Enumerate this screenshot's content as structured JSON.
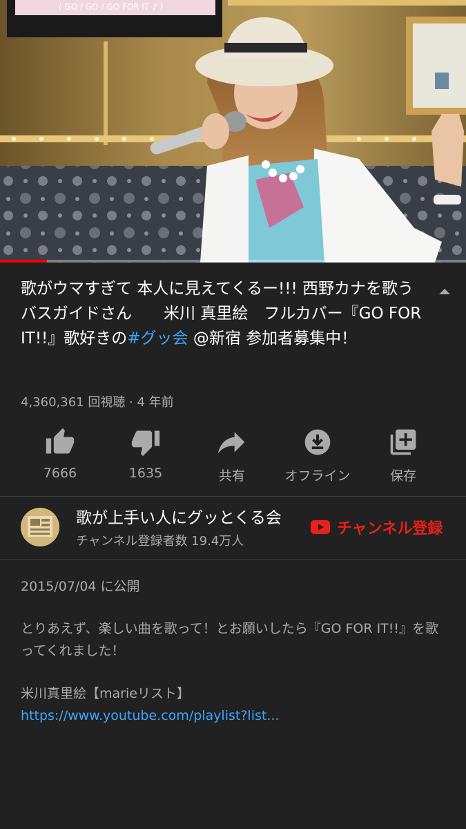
{
  "video": {
    "progress_fraction": 0.1,
    "screen_text": "GO / GO / GO FOR IT"
  },
  "title": {
    "text_before": "歌がウマすぎて 本人に見えてくるー!!!  西野カナを歌うバスガイドさん　　米川 真里絵　フルカバー『GO FOR IT!!』歌好きの",
    "hashtag": "#グッ会",
    "text_after": " @新宿 参加者募集中！",
    "expand_icon": "chevron-up-icon"
  },
  "meta": "4,360,361 回視聴 · 4 年前",
  "actions": [
    {
      "id": "like",
      "icon": "thumb-up-icon",
      "label": "7666"
    },
    {
      "id": "dislike",
      "icon": "thumb-down-icon",
      "label": "1635"
    },
    {
      "id": "share",
      "icon": "share-icon",
      "label": "共有"
    },
    {
      "id": "offline",
      "icon": "download-icon",
      "label": "オフライン"
    },
    {
      "id": "save",
      "icon": "playlist-add-icon",
      "label": "保存"
    }
  ],
  "channel": {
    "name": "歌が上手い人にグッとくる会",
    "subscribers": "チャンネル登録者数 19.4万人",
    "subscribe_label": "チャンネル登録"
  },
  "description": {
    "published": "2015/07/04 に公開",
    "line1": "とりあえず、楽しい曲を歌って！とお願いしたら『GO FOR IT!!』を歌ってくれました！",
    "line2": "米川真里絵【marieリスト】",
    "link": "https://www.youtube.com/playlist?list..."
  },
  "colors": {
    "background": "#212121",
    "accent_red": "#ff0000",
    "link_blue": "#3ea6ff",
    "secondary_text": "#aaaaaa"
  }
}
